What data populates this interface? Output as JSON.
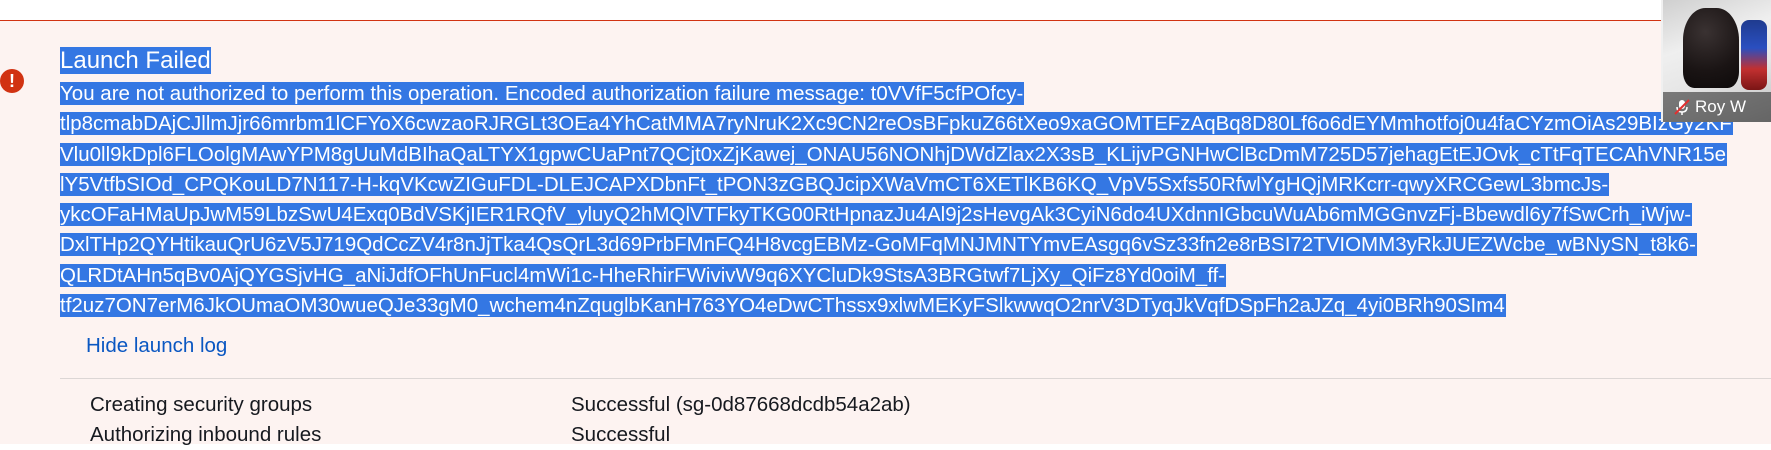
{
  "alert": {
    "icon": "error-exclamation-icon",
    "title": "Launch Failed",
    "message_lines": [
      "You are not authorized to perform this operation. Encoded authorization failure message: t0VVfF5cfPOfcy-",
      "tlp8cmabDAjCJllmJjr66mrbm1lCFYoX6cwzaoRJRGLt3OEa4YhCatMMA7ryNruK2Xc9CN2reOsBFpkuZ66tXeo9xaGOMTEFzAqBq8D80Lf6o6dEYMmhotfoj0u4faCYzmOiAs29BIzGy2KF",
      "Vlu0ll9kDpl6FLOolgMAwYPM8gUuMdBIhaQaLTYX1gpwCUaPnt7QCjt0xZjKawej_ONAU56NONhjDWdZlax2X3sB_KLijvPGNHwClBcDmM725D57jehagEtEJOvk_cTtFqTECAhVNR15e",
      "lY5VtfbSIOd_CPQKouLD7N117-H-kqVKcwZIGuFDL-DLEJCAPXDbnFt_tPON3zGBQJcipXWaVmCT6XETlKB6KQ_VpV5Sxfs50RfwlYgHQjMRKcrr-qwyXRCGewL3bmcJs-",
      "ykcOFaHMaUpJwM59LbzSwU4Exq0BdVSKjIER1RQfV_yluyQ2hMQlVTFkyTKG00RtHpnazJu4Al9j2sHevgAk3CyiN6do4UXdnnIGbcuWuAb6mMGGnvzFj-Bbewdl6y7fSwCrh_iWjw-",
      "DxlTHp2QYHtikauQrU6zV5J719QdCcZV4r8nJjTka4QsQrL3d69PrbFMnFQ4H8vcgEBMz-GoMFqMNJMNTYmvEAsgq6vSz33fn2e8rBSI72TVIOMM3yRkJUEZWcbe_wBNySN_t8k6-",
      "QLRDtAHn5qBv0AjQYGSjvHG_aNiJdfOFhUnFucl4mWi1c-HheRhirFWivivW9q6XYCluDk9StsA3BRGtwf7LjXy_QiFz8Yd0oiM_ff-",
      "tf2uz7ON7erM6JkOUmaOM30wueQJe33gM0_wchem4nZquglbKanH763YO4eDwCThssx9xlwMEKyFSlkwwqO2nrV3DTyqJkVqfDSpFh2aJZq_4yi0BRh90SIm4"
    ],
    "hide_log_label": "Hide launch log"
  },
  "launch_log": {
    "rows": [
      {
        "step": "Creating security groups",
        "status": "Successful (sg-0d87668dcdb54a2ab)"
      },
      {
        "step": "Authorizing inbound rules",
        "status": "Successful"
      }
    ]
  },
  "video_call": {
    "participant_name": "Roy W",
    "mic_icon": "microphone-muted-icon"
  },
  "colors": {
    "selection": "#3477e3",
    "error": "#d13212",
    "link": "#0a57c2",
    "panel_background": "#fdf3f1"
  }
}
